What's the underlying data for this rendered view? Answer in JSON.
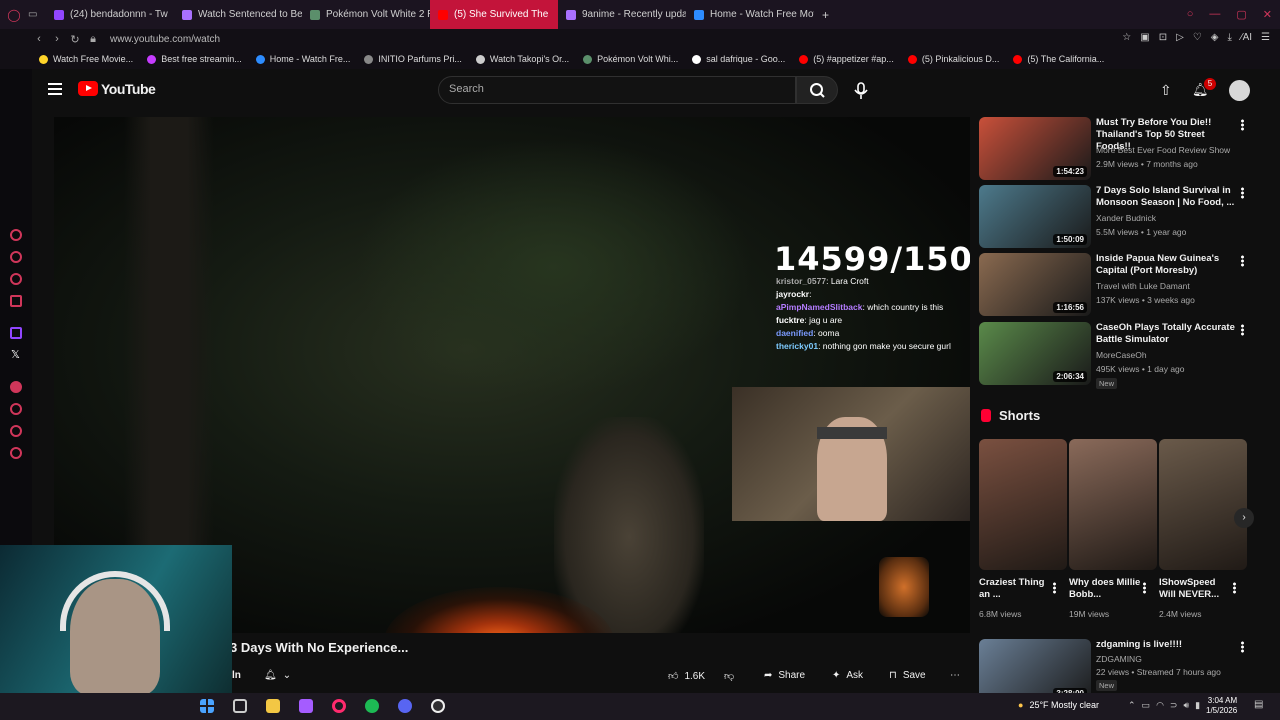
{
  "browser": {
    "tabs": [
      {
        "label": "(24) bendadonnn - Tw",
        "color": "#9146ff",
        "active": false
      },
      {
        "label": "Watch Sentenced to Be a",
        "color": "#a970ff",
        "active": false
      },
      {
        "label": "Pokémon Volt White 2 Re",
        "color": "#5b8f6b",
        "active": false
      },
      {
        "label": "(5) She Survived The",
        "color": "#ff0000",
        "active": true
      },
      {
        "label": "9anime - Recently update",
        "color": "#a970ff",
        "active": false
      },
      {
        "label": "Home - Watch Free Movie",
        "color": "#2d8cff",
        "active": false
      }
    ],
    "new_tab": "+",
    "url": "www.youtube.com/watch",
    "bookmarks": [
      {
        "label": "Watch Free Movie...",
        "color": "#ffd42a"
      },
      {
        "label": "Best free streamin...",
        "color": "#c63cff"
      },
      {
        "label": "Home - Watch Fre...",
        "color": "#2d8cff"
      },
      {
        "label": "INITIO Parfums Pri...",
        "color": "#888888"
      },
      {
        "label": "Watch Takopi's Or...",
        "color": "#cccccc"
      },
      {
        "label": "Pokémon Volt Whi...",
        "color": "#5b8f6b"
      },
      {
        "label": "sal dafrique - Goo...",
        "color": "#ffffff"
      },
      {
        "label": "(5) #appetizer #ap...",
        "color": "#ff0000"
      },
      {
        "label": "(5) Pinkalicious D...",
        "color": "#ff0000"
      },
      {
        "label": "(5) The California...",
        "color": "#ff0000"
      }
    ]
  },
  "youtube": {
    "logo_text": "YouTube",
    "search_placeholder": "Search",
    "notification_count": "5"
  },
  "video": {
    "counter": "14599/15000",
    "chat": [
      {
        "user": "kristor_0577",
        "msg": "Lara Croft",
        "color": "#aaaaaa"
      },
      {
        "user": "jayrockr",
        "msg": "",
        "color": "#ffffff"
      },
      {
        "user": "aPimpNamedSlitback",
        "msg": "which country is this",
        "color": "#b47cff"
      },
      {
        "user": "fucktre",
        "msg": "jag u are",
        "color": "#ffffff"
      },
      {
        "user": "daenified",
        "msg": "ooma",
        "color": "#7b9bff"
      },
      {
        "user": "thericky01",
        "msg": "nothing gon make you secure gurl",
        "color": "#7ecbff"
      }
    ],
    "title": "3 Days With No Experience...",
    "channel_short": "ln",
    "likes": "1.6K",
    "share_label": "Share",
    "ask_label": "Ask",
    "save_label": "Save"
  },
  "suggestions": [
    {
      "title": "Must Try Before You Die!! Thailand's Top 50 Street Foods!!",
      "channel": "More Best Ever Food Review Show",
      "meta": "2.9M views • 7 months ago",
      "duration": "1:54:23",
      "badge": "",
      "thumb_color": "#c9503a"
    },
    {
      "title": "7 Days Solo Island Survival in Monsoon Season | No Food, ...",
      "channel": "Xander Budnick",
      "meta": "5.5M views • 1 year ago",
      "duration": "1:50:09",
      "badge": "",
      "thumb_color": "#4d7a8c"
    },
    {
      "title": "Inside Papua New Guinea's Capital (Port Moresby)",
      "channel": "Travel with Luke Damant",
      "meta": "137K views • 3 weeks ago",
      "duration": "1:16:56",
      "badge": "",
      "thumb_color": "#8a6a50"
    },
    {
      "title": "CaseOh Plays Totally Accurate Battle Simulator",
      "channel": "MoreCaseOh",
      "meta": "495K views • 1 day ago",
      "duration": "2:06:34",
      "badge": "New",
      "thumb_color": "#5a8a4a"
    },
    {
      "title": "zdgaming is live!!!!",
      "channel": "ZDGAMING",
      "meta": "22 views • Streamed 7 hours ago",
      "duration": "3:28:00",
      "badge": "New",
      "thumb_color": "#6a7f96"
    }
  ],
  "shorts": {
    "heading": "Shorts",
    "items": [
      {
        "title": "Craziest Thing an ...",
        "views": "6.8M views",
        "color": "#7a5040"
      },
      {
        "title": "Why does Millie Bobb...",
        "views": "19M views",
        "color": "#8a6a5a"
      },
      {
        "title": "IShowSpeed Will NEVER...",
        "views": "2.4M views",
        "color": "#6a5a4a"
      }
    ]
  },
  "taskbar": {
    "weather": "25°F  Mostly clear",
    "time": "3:04 AM",
    "date": "1/5/2026"
  }
}
